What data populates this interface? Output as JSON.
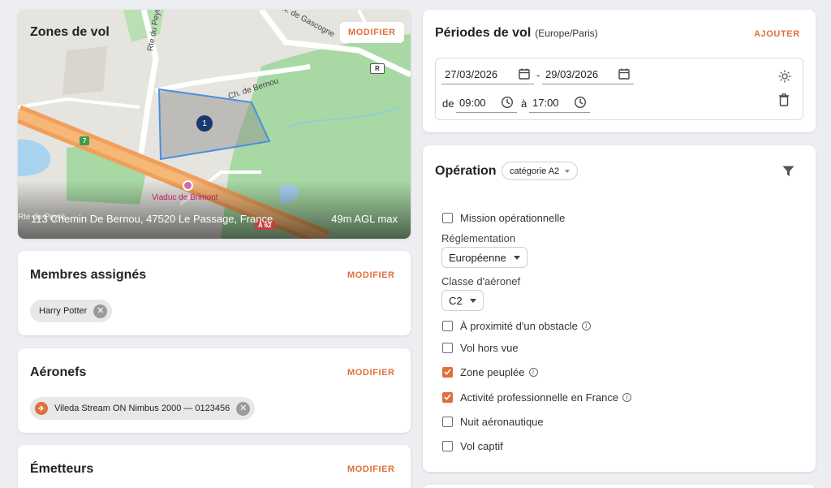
{
  "zones": {
    "title": "Zones de vol",
    "edit_label": "MODIFIER",
    "address": "113 Chemin De Bernou, 47520 Le Passage, France",
    "altitude": "49m AGL max",
    "map": {
      "road_labels": [
        "Rte du Peyré",
        "Ch. de Bernou",
        "Av. de Gascogne",
        "Viaduc de Brimont",
        "Rte du Peyré"
      ],
      "road_shields": [
        "7",
        "R",
        "A 62"
      ],
      "zone_marker": "1",
      "colors": {
        "water": "#a8d3f0",
        "park": "#a8d9a4",
        "highway": "#f0a05a",
        "zone_stroke": "#4a8fe0",
        "marker": "#1a3a6e"
      }
    }
  },
  "members": {
    "title": "Membres assignés",
    "edit_label": "MODIFIER",
    "chips": [
      {
        "label": "Harry Potter"
      }
    ]
  },
  "aircraft": {
    "title": "Aéronefs",
    "edit_label": "MODIFIER",
    "chips": [
      {
        "label": "Vileda Stream ON Nimbus 2000 — 0123456",
        "icon": "aircraft-brand-icon"
      }
    ]
  },
  "emitters": {
    "title": "Émetteurs",
    "edit_label": "MODIFIER"
  },
  "periods": {
    "title": "Périodes de vol",
    "timezone": "(Europe/Paris)",
    "add_label": "AJOUTER",
    "start_date": "27/03/2026",
    "end_date": "29/03/2026",
    "date_separator": "-",
    "from_label": "de",
    "start_time": "09:00",
    "to_label": "à",
    "end_time": "17:00"
  },
  "operation": {
    "title": "Opération",
    "category": "catégorie A2",
    "mission_label": "Mission opérationnelle",
    "mission_checked": false,
    "regulation_label": "Réglementation",
    "regulation_value": "Européenne",
    "class_label": "Classe d'aéronef",
    "class_value": "C2",
    "options": [
      {
        "label": "À proximité d'un obstacle",
        "checked": false,
        "info": true
      },
      {
        "label": "Vol hors vue",
        "checked": false,
        "info": false
      },
      {
        "label": "Zone peuplée",
        "checked": true,
        "info": true
      },
      {
        "label": "Activité professionnelle en France",
        "checked": true,
        "info": true
      },
      {
        "label": "Nuit aéronautique",
        "checked": false,
        "info": false
      },
      {
        "label": "Vol captif",
        "checked": false,
        "info": false
      }
    ],
    "accent_color": "#e0703a"
  }
}
